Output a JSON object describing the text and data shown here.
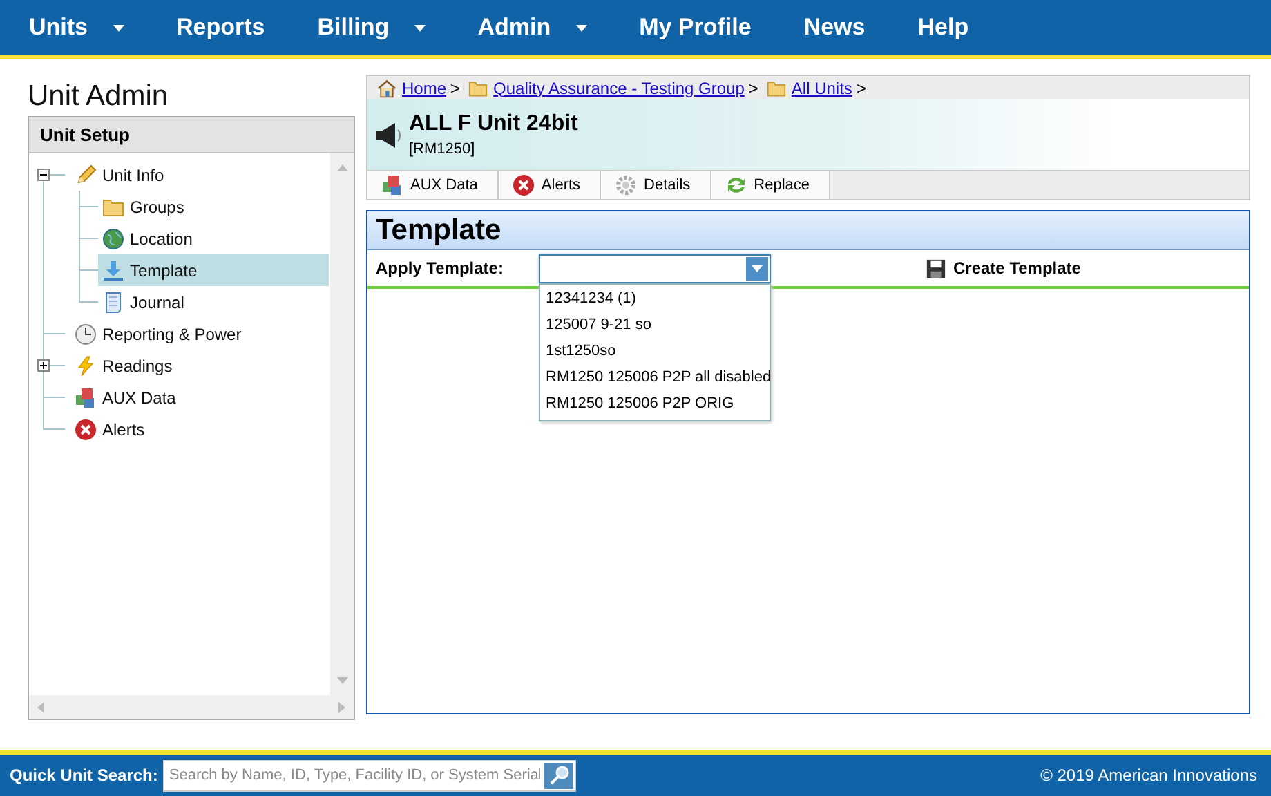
{
  "nav": [
    {
      "label": "Units",
      "dropdown": true
    },
    {
      "label": "Reports",
      "dropdown": false
    },
    {
      "label": "Billing",
      "dropdown": true
    },
    {
      "label": "Admin",
      "dropdown": true
    },
    {
      "label": "My Profile",
      "dropdown": false
    },
    {
      "label": "News",
      "dropdown": false
    },
    {
      "label": "Help",
      "dropdown": false
    }
  ],
  "page_title": "Unit Admin",
  "sidebar": {
    "title": "Unit Setup",
    "items": [
      {
        "label": "Unit Info",
        "expanded": true,
        "selected": false,
        "children": [
          {
            "label": "Groups",
            "selected": false
          },
          {
            "label": "Location",
            "selected": false
          },
          {
            "label": "Template",
            "selected": true
          },
          {
            "label": "Journal",
            "selected": false
          }
        ]
      },
      {
        "label": "Reporting & Power",
        "selected": false
      },
      {
        "label": "Readings",
        "expanded": false,
        "selected": false
      },
      {
        "label": "AUX Data",
        "selected": false
      },
      {
        "label": "Alerts",
        "selected": false
      }
    ]
  },
  "breadcrumb": [
    "Home",
    "Quality Assurance - Testing Group",
    "All Units"
  ],
  "breadcrumb_separator": ">",
  "unit": {
    "name": "ALL F Unit 24bit",
    "id": "[RM1250]"
  },
  "toolbar": [
    "AUX Data",
    "Alerts",
    "Details",
    "Replace"
  ],
  "section": {
    "title": "Template",
    "apply_label": "Apply Template:",
    "create_button": "Create Template",
    "dropdown": {
      "open": true,
      "options": [
        "12341234 (1)",
        "125007 9-21 so",
        "1st1250so",
        "RM1250 125006 P2P all disabled",
        "RM1250 125006 P2P ORIG"
      ]
    }
  },
  "footer": {
    "search_label": "Quick Unit Search:",
    "search_placeholder": "Search by Name, ID, Type, Facility ID, or System Serial",
    "copyright": "© 2019 American Innovations"
  }
}
